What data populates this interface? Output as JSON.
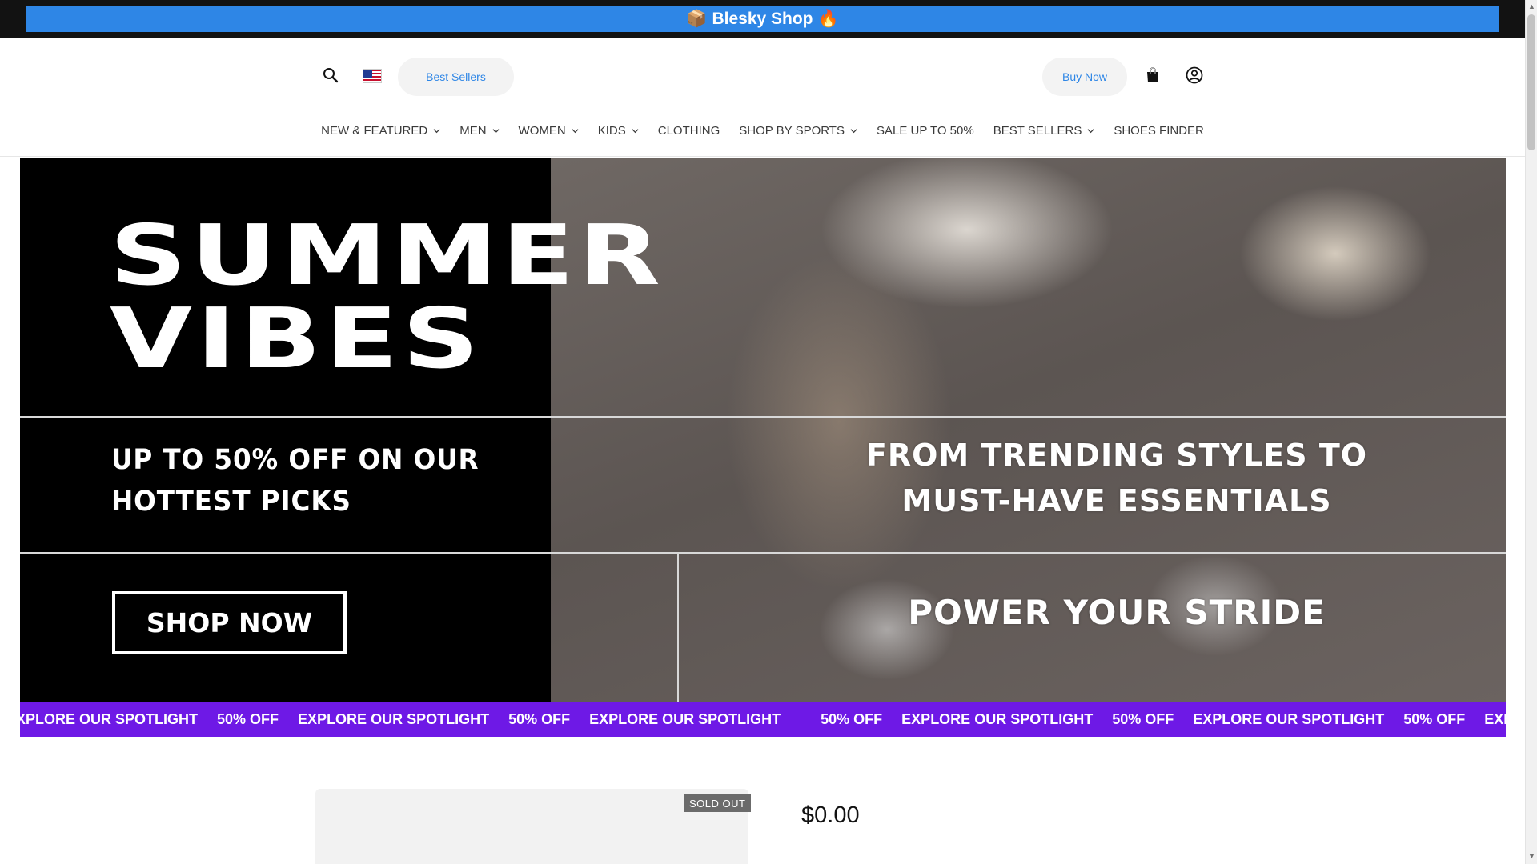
{
  "announcement": {
    "icon_left": "📦",
    "text": "Blesky Shop",
    "icon_right": "🔥"
  },
  "header": {
    "search_icon": "search-icon",
    "flag": "us-flag-icon",
    "best_sellers_label": "Best Sellers",
    "buy_now_label": "Buy Now",
    "cart_icon": "shopping-bag-icon",
    "account_icon": "account-icon",
    "accent_color": "#2e86e6"
  },
  "nav": [
    {
      "label": "NEW & FEATURED",
      "dropdown": true
    },
    {
      "label": "MEN",
      "dropdown": true
    },
    {
      "label": "WOMEN",
      "dropdown": true
    },
    {
      "label": "KIDS",
      "dropdown": true
    },
    {
      "label": "CLOTHING",
      "dropdown": false
    },
    {
      "label": "SHOP BY SPORTS",
      "dropdown": true
    },
    {
      "label": "SALE UP TO 50%",
      "dropdown": false
    },
    {
      "label": "BEST SELLERS",
      "dropdown": true
    },
    {
      "label": "SHOES FINDER",
      "dropdown": false
    }
  ],
  "hero": {
    "title_line1": "SUMMER",
    "title_line2": "VIBES",
    "subtitle_line1": "UP TO 50% OFF ON OUR",
    "subtitle_line2": "HOTTEST PICKS",
    "cta_label": "SHOP NOW",
    "right_line1": "FROM TRENDING STYLES TO",
    "right_line2": "MUST-HAVE ESSENTIALS",
    "right_tagline": "POWER YOUR STRIDE"
  },
  "marquee": {
    "background": "#6e19e6",
    "items": [
      "XPLORE OUR SPOTLIGHT",
      "50% OFF",
      "EXPLORE OUR SPOTLIGHT",
      "50% OFF",
      "EXPLORE OUR SPOTLIGHT",
      "50% OFF",
      "EXPLORE OUR SPOTLIGHT",
      "50% OFF",
      "EXPLORE OUR SPOTLIGHT",
      "50% OFF",
      "EXPLORE OUR"
    ]
  },
  "product": {
    "badge": "SOLD OUT",
    "price": "$0.00"
  }
}
